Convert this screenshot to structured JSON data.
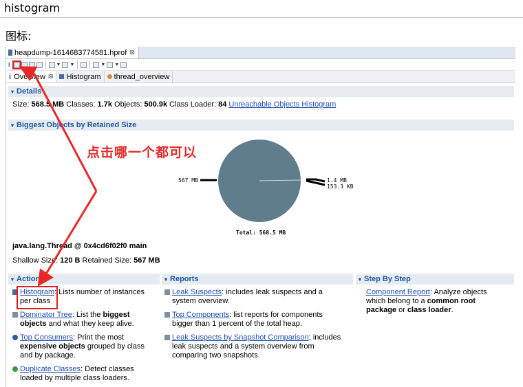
{
  "page": {
    "heading": "histogram",
    "subheading": "图标:"
  },
  "editor": {
    "file_tab": "heapdump-1614683774581.hprof",
    "subtabs": [
      "Overview",
      "Histogram",
      "thread_overview"
    ]
  },
  "details": {
    "title": "Details",
    "size_label": "Size:",
    "size_value": "568.5 MB",
    "classes_label": "Classes:",
    "classes_value": "1.7k",
    "objects_label": "Objects:",
    "objects_value": "500.9k",
    "loader_label": "Class Loader:",
    "loader_value": "84",
    "unreachable_link": "Unreachable Objects Histogram"
  },
  "biggest": {
    "title": "Biggest Objects by Retained Size",
    "thread": "java.lang.Thread @ 0x4cd6f02f0 main",
    "shallow_label": "Shallow Size:",
    "shallow_value": "120 B",
    "retained_label": "Retained Size:",
    "retained_value": "567 MB",
    "pie_total": "Total: 568.5 MB",
    "pie_colors": {
      "main": "#5f7d8c",
      "bg": "#ffffff"
    }
  },
  "chart_data": {
    "type": "pie",
    "labels": [
      "567 MB",
      "1.4 MB",
      "153.3 KB"
    ],
    "values": [
      567,
      1.4,
      0.15
    ],
    "title": "Total: 568.5 MB"
  },
  "annotation": {
    "text": "点击哪一个都可以",
    "color": "#e62828"
  },
  "actions": {
    "title": "Actions",
    "items": [
      {
        "link": "Histogram",
        "text": ": Lists number of instances per class"
      },
      {
        "link": "Dominator Tree",
        "text_pre": ": List the ",
        "bold": "biggest objects",
        "text_post": " and what they keep alive."
      },
      {
        "link": "Top Consumers",
        "text_pre": ": Print the most ",
        "bold": "expensive objects",
        "text_post": " grouped by class and by package."
      },
      {
        "link": "Duplicate Classes",
        "text": ": Detect classes loaded by multiple class loaders."
      }
    ]
  },
  "reports": {
    "title": "Reports",
    "items": [
      {
        "link": "Leak Suspects",
        "text": ": includes leak suspects and a system overview."
      },
      {
        "link": "Top Components",
        "text": ": list reports for components bigger than 1 percent of the total heap."
      },
      {
        "link": "Leak Suspects by Snapshot Comparison",
        "text": ": includes leak suspects and a system overview from comparing two snapshots."
      }
    ]
  },
  "steps": {
    "title": "Step By Step",
    "items": [
      {
        "link": "Component Report",
        "text_pre": ": Analyze objects which belong to a ",
        "bold": "common root package",
        "text_mid": " or ",
        "bold2": "class loader",
        "text_post": "."
      }
    ]
  }
}
